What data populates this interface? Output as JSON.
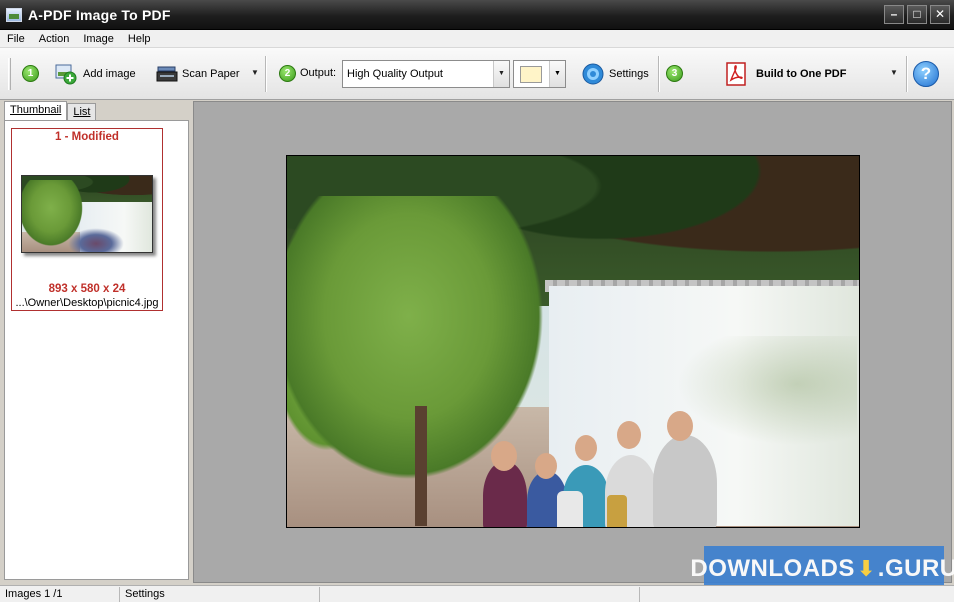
{
  "window": {
    "title": "A-PDF Image To PDF",
    "minimize": "–",
    "maximize": "□",
    "close": "✕"
  },
  "menu": [
    "File",
    "Action",
    "Image",
    "Help"
  ],
  "toolbar": {
    "step1": "1",
    "step2": "2",
    "step3": "3",
    "add_image": "Add image",
    "scan_paper": "Scan Paper",
    "output_label": "Output:",
    "output_value": "High Quality Output",
    "settings": "Settings",
    "build": "Build to One PDF",
    "help": "?"
  },
  "colors": {
    "background_swatch": "#fff4c8",
    "accent_red": "#c0302a",
    "watermark_blue": "#3d80d0"
  },
  "tabs": [
    "Thumbnail",
    "List"
  ],
  "thumbnail": {
    "title": "1 - Modified",
    "dims": "893 x 580 x 24",
    "path": "...\\Owner\\Desktop\\picnic4.jpg"
  },
  "status": {
    "images": "Images 1 /1",
    "settings": "Settings"
  },
  "watermark": {
    "left": "DOWNLOADS",
    "right": ".GURU"
  },
  "icons": [
    "app-icon",
    "add-image-icon",
    "scanner-icon",
    "settings-gear-icon",
    "pdf-icon",
    "help-icon"
  ]
}
